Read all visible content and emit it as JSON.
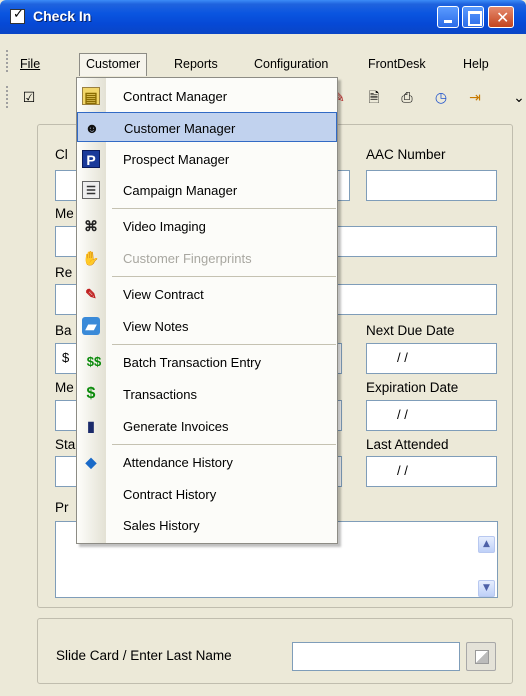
{
  "window": {
    "title": "Check In"
  },
  "menubar": {
    "items": [
      {
        "label": "File"
      },
      {
        "label": "Customer"
      },
      {
        "label": "Reports"
      },
      {
        "label": "Configuration"
      },
      {
        "label": "FrontDesk"
      },
      {
        "label": "Help"
      }
    ]
  },
  "dropdown": {
    "items": [
      {
        "label": "Contract Manager",
        "icon": "contract-manager-icon"
      },
      {
        "label": "Customer Manager",
        "icon": "customer-manager-icon",
        "highlighted": true
      },
      {
        "label": "Prospect Manager",
        "icon": "prospect-manager-icon"
      },
      {
        "label": "Campaign Manager",
        "icon": "campaign-manager-icon"
      },
      {
        "label": "Video Imaging",
        "icon": "camera-icon"
      },
      {
        "label": "Customer Fingerprints",
        "icon": "hand-icon",
        "disabled": true
      },
      {
        "label": "View Contract",
        "icon": "edit-contract-icon"
      },
      {
        "label": "View Notes",
        "icon": "notes-icon"
      },
      {
        "label": "Batch Transaction Entry",
        "icon": "batch-dollar-icon"
      },
      {
        "label": "Transactions",
        "icon": "dollar-icon"
      },
      {
        "label": "Generate Invoices",
        "icon": "invoice-icon"
      },
      {
        "label": "Attendance History",
        "icon": "attendance-icon"
      },
      {
        "label": "Contract History",
        "icon": ""
      },
      {
        "label": "Sales History",
        "icon": ""
      }
    ]
  },
  "form": {
    "labels": {
      "club_partial": "Cl",
      "aac_number": "AAC Number",
      "member_partial": "Me",
      "re_partial": "Re",
      "balance_partial": "Ba",
      "next_due_date": "Next Due Date",
      "me2_partial": "Me",
      "expiration_date": "Expiration Date",
      "status_partial": "Sta",
      "last_attended": "Last Attended",
      "pr_partial": "Pr"
    },
    "values": {
      "balance_prefix": "$",
      "next_due_date": "/   /",
      "expiration_date": "/   /",
      "last_attended": "/   /"
    }
  },
  "slide": {
    "label": "Slide Card / Enter Last Name",
    "value": ""
  }
}
